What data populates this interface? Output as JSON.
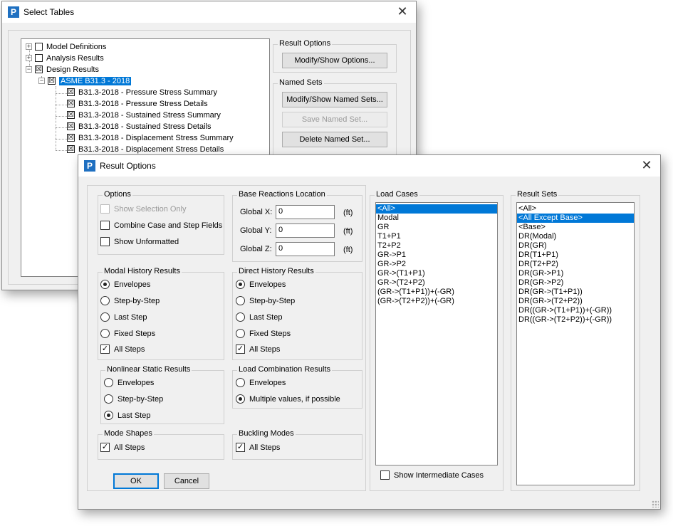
{
  "select_tables": {
    "title": "Select Tables",
    "tree": [
      {
        "label": "Model Definitions",
        "check": "",
        "expander": "+"
      },
      {
        "label": "Analysis Results",
        "check": "",
        "expander": "+"
      },
      {
        "label": "Design Results",
        "check": "☒",
        "expander": "−"
      },
      {
        "label": "ASME B31.3 - 2018",
        "check": "☒",
        "expander": "−",
        "selected": true
      },
      {
        "label": "B31.3-2018 - Pressure Stress Summary",
        "check": "☒"
      },
      {
        "label": "B31.3-2018 - Pressure Stress Details",
        "check": "☒"
      },
      {
        "label": "B31.3-2018 - Sustained Stress Summary",
        "check": "☒"
      },
      {
        "label": "B31.3-2018 - Sustained Stress Details",
        "check": "☒"
      },
      {
        "label": "B31.3-2018 - Displacement Stress Summary",
        "check": "☒"
      },
      {
        "label": "B31.3-2018 - Displacement Stress Details",
        "check": "☒"
      }
    ],
    "result_options_label": "Result Options",
    "modify_show_options": "Modify/Show Options...",
    "named_sets_label": "Named Sets",
    "modify_show_named_sets": "Modify/Show Named Sets...",
    "save_named_set": "Save Named Set...",
    "delete_named_set": "Delete Named Set..."
  },
  "result_options": {
    "title": "Result Options",
    "options": {
      "label": "Options",
      "show_selection_only": "Show Selection Only",
      "combine_case_step": "Combine Case and Step Fields",
      "show_unformatted": "Show Unformatted"
    },
    "base_reactions": {
      "label": "Base Reactions Location",
      "global_x_label": "Global X:",
      "global_x": "0",
      "global_y_label": "Global Y:",
      "global_y": "0",
      "global_z_label": "Global Z:",
      "global_z": "0",
      "unit": "(ft)"
    },
    "modal_history": {
      "label": "Modal History Results",
      "envelopes": "Envelopes",
      "step_by_step": "Step-by-Step",
      "last_step": "Last Step",
      "fixed_steps": "Fixed Steps",
      "all_steps": "All Steps"
    },
    "direct_history": {
      "label": "Direct History Results",
      "envelopes": "Envelopes",
      "step_by_step": "Step-by-Step",
      "last_step": "Last Step",
      "fixed_steps": "Fixed Steps",
      "all_steps": "All Steps"
    },
    "nonlinear_static": {
      "label": "Nonlinear Static Results",
      "envelopes": "Envelopes",
      "step_by_step": "Step-by-Step",
      "last_step": "Last Step"
    },
    "load_combination": {
      "label": "Load Combination Results",
      "envelopes": "Envelopes",
      "multiple_values": "Multiple values, if possible"
    },
    "mode_shapes": {
      "label": "Mode Shapes",
      "all_steps": "All Steps"
    },
    "buckling_modes": {
      "label": "Buckling Modes",
      "all_steps": "All Steps"
    },
    "ok": "OK",
    "cancel": "Cancel",
    "load_cases": {
      "label": "Load Cases",
      "items": [
        "<All>",
        "Modal",
        "GR",
        "T1+P1",
        "T2+P2",
        "GR->P1",
        "GR->P2",
        "GR->(T1+P1)",
        "GR->(T2+P2)",
        "(GR->(T1+P1))+(-GR)",
        "(GR->(T2+P2))+(-GR)"
      ],
      "selected_index": 0,
      "show_intermediate": "Show Intermediate Cases"
    },
    "result_sets": {
      "label": "Result Sets",
      "items": [
        "<All>",
        "<All Except Base>",
        "<Base>",
        "DR(Modal)",
        "DR(GR)",
        "DR(T1+P1)",
        "DR(T2+P2)",
        "DR(GR->P1)",
        "DR(GR->P2)",
        "DR(GR->(T1+P1))",
        "DR(GR->(T2+P2))",
        "DR((GR->(T1+P1))+(-GR))",
        "DR((GR->(T2+P2))+(-GR))"
      ],
      "selected_index": 1
    }
  }
}
